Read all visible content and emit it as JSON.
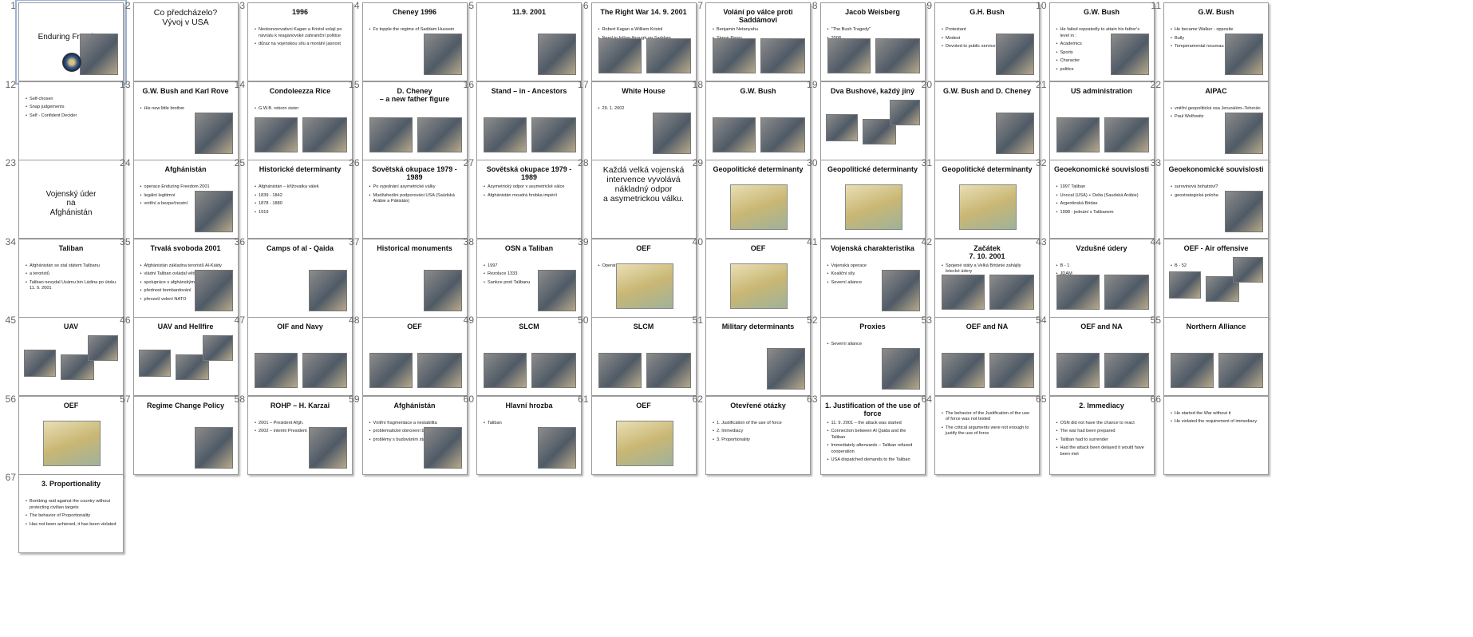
{
  "sorter": {
    "slides": [
      {
        "n": "1",
        "title": "Enduring Freedom",
        "style": "center",
        "bullets": [],
        "images": 1
      },
      {
        "n": "2",
        "title": "Co předcházelo?\nVývoj v USA",
        "style": "big",
        "bullets": [],
        "images": 0
      },
      {
        "n": "3",
        "title": "1996",
        "bullets": [
          "Neokonzervativci Kagan a Kristol volají po návratu k reaganovské zahraniční politice",
          "důraz na vojenskou sílu a morální jasnost"
        ],
        "images": 0
      },
      {
        "n": "4",
        "title": "Cheney 1996",
        "bullets": [
          "Fo topple the regime of Saddam Hussein"
        ],
        "images": 1
      },
      {
        "n": "5",
        "title": "11.9. 2001",
        "bullets": [],
        "images": 1
      },
      {
        "n": "6",
        "title": "The Right War 14. 9. 2001",
        "bullets": [
          "Robert Kagan a William Kristol",
          "Need to follow through on Saddam"
        ],
        "images": 2
      },
      {
        "n": "7",
        "title": "Volání po válce proti Saddámovi",
        "bullets": [
          "Benjamin Netanyahu",
          "Simon Peres",
          "Ehud Barak"
        ],
        "images": 2
      },
      {
        "n": "8",
        "title": "Jacob Weisberg",
        "bullets": [
          "\"The Bush Tragedy\"",
          "2008"
        ],
        "images": 2
      },
      {
        "n": "9",
        "title": "G.H. Bush",
        "bullets": [
          "Protestant",
          "Modest",
          "Devoted to public service"
        ],
        "images": 1
      },
      {
        "n": "10",
        "title": "G.W. Bush",
        "bullets": [
          "He failed repeatedly to attain his father's level in :",
          "Academics",
          "Sports",
          "Character",
          "politics"
        ],
        "images": 1
      },
      {
        "n": "11",
        "title": "G.W. Bush",
        "bullets": [
          "He became Walker - opposite",
          "Bully",
          "Temperamental nouveau riche"
        ],
        "images": 1
      },
      {
        "n": "12",
        "title": "",
        "bullets": [
          "Self-chosen",
          "Snap judgements",
          "Self - Confident Decider"
        ],
        "images": 0
      },
      {
        "n": "13",
        "title": "G.W. Bush and Karl Rove",
        "bullets": [
          "His new little brother"
        ],
        "images": 1
      },
      {
        "n": "14",
        "title": "Condoleezza Rice",
        "bullets": [
          "G.W.B. reborn sister"
        ],
        "images": 2
      },
      {
        "n": "15",
        "title": "D. Cheney\n– a new father figure",
        "bullets": [],
        "images": 2
      },
      {
        "n": "16",
        "title": "Stand – in - Ancestors",
        "bullets": [],
        "images": 2
      },
      {
        "n": "17",
        "title": "White House",
        "bullets": [
          "29. 1. 2002"
        ],
        "images": 1
      },
      {
        "n": "18",
        "title": "G.W. Bush",
        "bullets": [],
        "images": 2
      },
      {
        "n": "19",
        "title": "Dva Bushové, každý jiný",
        "bullets": [],
        "images": 3
      },
      {
        "n": "20",
        "title": "G.W. Bush and D. Cheney",
        "bullets": [],
        "images": 1
      },
      {
        "n": "21",
        "title": "US administration",
        "bullets": [],
        "images": 2
      },
      {
        "n": "22",
        "title": "AIPAC",
        "bullets": [
          "vnitřní geopolitická osa Jeruzalém–Teherán",
          "Paul Wolfowitz"
        ],
        "images": 1
      },
      {
        "n": "23",
        "title": "Vojenský úder\nna\nAfghánistán",
        "style": "center",
        "bullets": [],
        "images": 0
      },
      {
        "n": "24",
        "title": "Afghánistán",
        "bullets": [
          "operace Enduring Freedom 2001",
          "legální legitimní",
          "vnitřní a bezpečnostní"
        ],
        "images": 1
      },
      {
        "n": "25",
        "title": "Historické determinanty",
        "bullets": [
          "Afghánistán – křižovatka válek",
          "1839 - 1842",
          "1878 - 1880",
          "1919"
        ],
        "images": 0
      },
      {
        "n": "26",
        "title": "Sovětská okupace 1979 - 1989",
        "bullets": [
          "Po vyjednání asymetrické války",
          "Mudžahedíni podporováni USA (Saúdská Arábie a Pákistán)"
        ],
        "images": 0
      },
      {
        "n": "27",
        "title": "Sovětská okupace 1979 - 1989",
        "bullets": [
          "Asymetrický odpor v asymetrické válce",
          "Afghánistán moudrá hrobka impérií"
        ],
        "images": 0
      },
      {
        "n": "28",
        "title": "Každá velká vojenská intervence vyvolává nákladný odpor\na asymetrickou válku.",
        "style": "big",
        "bullets": [],
        "images": 0
      },
      {
        "n": "29",
        "title": "Geopolitické determinanty",
        "bullets": [],
        "images": 1
      },
      {
        "n": "30",
        "title": "Geopolitické determinanty",
        "bullets": [],
        "images": 1
      },
      {
        "n": "31",
        "title": "Geopolitické determinanty",
        "bullets": [],
        "images": 1
      },
      {
        "n": "32",
        "title": "Geoekonomické souvislosti",
        "bullets": [
          "1997 Taliban",
          "Unocal (USA) + Delta (Saudská Arábie)",
          "Argentinská Bridas",
          "1998 - jednání s Talibanem"
        ],
        "images": 0
      },
      {
        "n": "33",
        "title": "Geoekonomické souvislosti",
        "bullets": [
          "surovinová bohatství?",
          "geostrategická poloha"
        ],
        "images": 1
      },
      {
        "n": "34",
        "title": "Taliban",
        "bullets": [
          "Afghánistán se stal státem Talibanu",
          "a teroristů",
          "Taliban nevydal Usámu bin Ládina po útoku 11. 9. 2001"
        ],
        "images": 0
      },
      {
        "n": "35",
        "title": "Trvalá svoboda 2001",
        "bullets": [
          "Afghánistán základna teroristů Al-Káidy",
          "vládní Taliban ovládal většinu území",
          "spolupráce s afghánskými vůdci",
          "přednost bombardování",
          "převzetí velení NATO"
        ],
        "images": 1
      },
      {
        "n": "36",
        "title": "Camps of al - Qaida",
        "bullets": [],
        "images": 1
      },
      {
        "n": "37",
        "title": "Historical monuments",
        "bullets": [],
        "images": 1
      },
      {
        "n": "38",
        "title": "OSN a Taliban",
        "bullets": [
          "1997",
          "Rezoluce 1333",
          "Sankce proti Talibanu"
        ],
        "images": 1
      },
      {
        "n": "39",
        "title": "OEF",
        "bullets": [
          "Operation Enduring Freedom"
        ],
        "images": 1
      },
      {
        "n": "40",
        "title": "OEF",
        "bullets": [],
        "images": 1
      },
      {
        "n": "41",
        "title": "Vojenská charakteristika",
        "bullets": [
          "Vojenská operace",
          "Koaliční síly",
          "Severní aliance"
        ],
        "images": 1
      },
      {
        "n": "42",
        "title": "Začátek\n7. 10. 2001",
        "bullets": [
          "Spojené státy a Velká Británie zahájily letecké údery"
        ],
        "images": 2
      },
      {
        "n": "43",
        "title": "Vzdušné údery",
        "bullets": [
          "B - 1",
          "JDAM"
        ],
        "images": 2
      },
      {
        "n": "44",
        "title": "OEF - Air offensive",
        "bullets": [
          "B - 52"
        ],
        "images": 3
      },
      {
        "n": "45",
        "title": "UAV",
        "bullets": [],
        "images": 3
      },
      {
        "n": "46",
        "title": "UAV and Hellfire",
        "bullets": [],
        "images": 3
      },
      {
        "n": "47",
        "title": "OIF and Navy",
        "bullets": [],
        "images": 2
      },
      {
        "n": "48",
        "title": "OEF",
        "bullets": [],
        "images": 2
      },
      {
        "n": "49",
        "title": "SLCM",
        "bullets": [],
        "images": 2
      },
      {
        "n": "50",
        "title": "SLCM",
        "bullets": [],
        "images": 2
      },
      {
        "n": "51",
        "title": "Military determinants",
        "bullets": [],
        "images": 1
      },
      {
        "n": "52",
        "title": "Proxies",
        "bullets": [
          "Severní aliance"
        ],
        "images": 1
      },
      {
        "n": "53",
        "title": "OEF and NA",
        "bullets": [],
        "images": 2
      },
      {
        "n": "54",
        "title": "OEF and NA",
        "bullets": [],
        "images": 2
      },
      {
        "n": "55",
        "title": "Northern Alliance",
        "bullets": [],
        "images": 2
      },
      {
        "n": "56",
        "title": "OEF",
        "bullets": [],
        "images": 1
      },
      {
        "n": "57",
        "title": "Regime Change Policy",
        "bullets": [],
        "images": 1
      },
      {
        "n": "58",
        "title": "ROHP – H. Karzai",
        "bullets": [
          "2001 – President Afgh.",
          "2002 – interim President"
        ],
        "images": 1
      },
      {
        "n": "59",
        "title": "Afghánistán",
        "bullets": [
          "Vnitřní fragmentace a nestabilita",
          "problematické obnovení bezpečnosti",
          "problémy s budováním státu"
        ],
        "images": 1
      },
      {
        "n": "60",
        "title": "Hlavní hrozba",
        "bullets": [
          "Taliban"
        ],
        "images": 1
      },
      {
        "n": "61",
        "title": "OEF",
        "bullets": [],
        "images": 1
      },
      {
        "n": "62",
        "title": "Otevřené otázky",
        "bullets": [
          "1. Justification of the use of force",
          "2. Immediacy",
          "3. Proportionality"
        ],
        "images": 0
      },
      {
        "n": "63",
        "title": "1. Justification of the use of force",
        "bullets": [
          "11. 9. 2001 – the attack was started",
          "Connection between Al Qaida and the Taliban",
          "Immediately afterwards – Taliban refused cooperation",
          "USA dispatched demands to the Taliban"
        ],
        "images": 0
      },
      {
        "n": "64",
        "title": "",
        "bullets": [
          "The behavior of the Justification of the use of force was not tested",
          "The critical arguments were not enough to justify the use of force"
        ],
        "images": 0
      },
      {
        "n": "65",
        "title": "2. Immediacy",
        "bullets": [
          "OSN did not have the chance to react",
          "The war had been prepared",
          "Taliban had to surrender",
          "Had the attack been delayed it would have been met"
        ],
        "images": 0
      },
      {
        "n": "66",
        "title": "",
        "bullets": [
          "He started the War without it",
          "He violated the requirement of immediacy"
        ],
        "images": 0
      },
      {
        "n": "67",
        "title": "3. Proportionality",
        "bullets": [
          "Bombing raid against the country without protecting civilian targets",
          "The behavior of Proportionality",
          "Has not been achieved, it has been violated"
        ],
        "images": 0
      }
    ]
  }
}
